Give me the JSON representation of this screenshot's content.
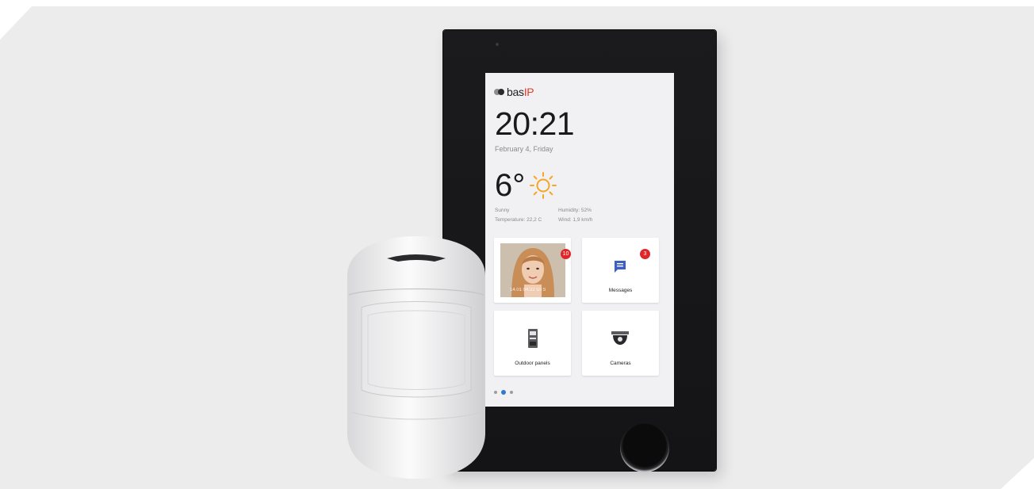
{
  "brand": {
    "logo_text_prefix": "bas",
    "logo_text_suffix": "IP"
  },
  "clock": {
    "time": "20:21",
    "date": "February 4, Friday"
  },
  "weather": {
    "temperature": "6°",
    "condition": "Sunny",
    "humidity": "Humidity: 52%",
    "indoor_temperature": "Temperature: 22,2 C",
    "wind": "Wind: 1,9 km/h",
    "icon": "sun-icon"
  },
  "tiles": [
    {
      "name": "calls",
      "label": "",
      "badge": "10",
      "caption": "14.01  04:22  DTS"
    },
    {
      "name": "messages",
      "label": "Messages",
      "badge": "3",
      "icon": "message-icon"
    },
    {
      "name": "outdoor-panels",
      "label": "Outdoor panels",
      "icon": "intercom-panel-icon"
    },
    {
      "name": "cameras",
      "label": "Cameras",
      "icon": "dome-camera-icon"
    }
  ],
  "pager": {
    "pages": 3,
    "active_index": 1
  },
  "colors": {
    "accent": "#2e7ad1",
    "badge": "#e0262a",
    "brand_red": "#e23b2e",
    "sun": "#f5a623"
  }
}
